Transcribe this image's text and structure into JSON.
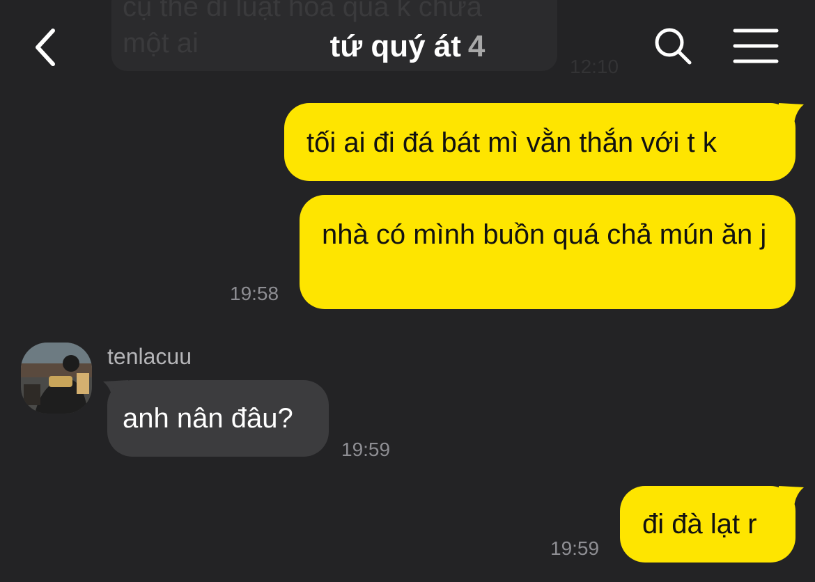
{
  "header": {
    "title": "tứ quý át",
    "member_count": "4",
    "back_icon": "chevron-left-icon",
    "search_icon": "search-icon",
    "menu_icon": "hamburger-menu-icon"
  },
  "previous_message": {
    "text": "cụ thể đi luật hoa quả k chừa\nmột ai",
    "time": "12:10"
  },
  "messages": [
    {
      "sender": "me",
      "text": "tối ai đi đá bát mì vằn thắn với t k",
      "time": ""
    },
    {
      "sender": "me",
      "text": "nhà có mình buồn quá chả mún ăn j",
      "time": "19:58"
    },
    {
      "sender": "tenlacuu",
      "text": "anh nân đâu?",
      "time": "19:59"
    },
    {
      "sender": "me",
      "text": "đi đà lạt r",
      "time": "19:59"
    }
  ],
  "colors": {
    "background": "#232325",
    "my_bubble": "#fee500",
    "other_bubble": "#3c3c3e",
    "timestamp": "#8e8e93"
  }
}
